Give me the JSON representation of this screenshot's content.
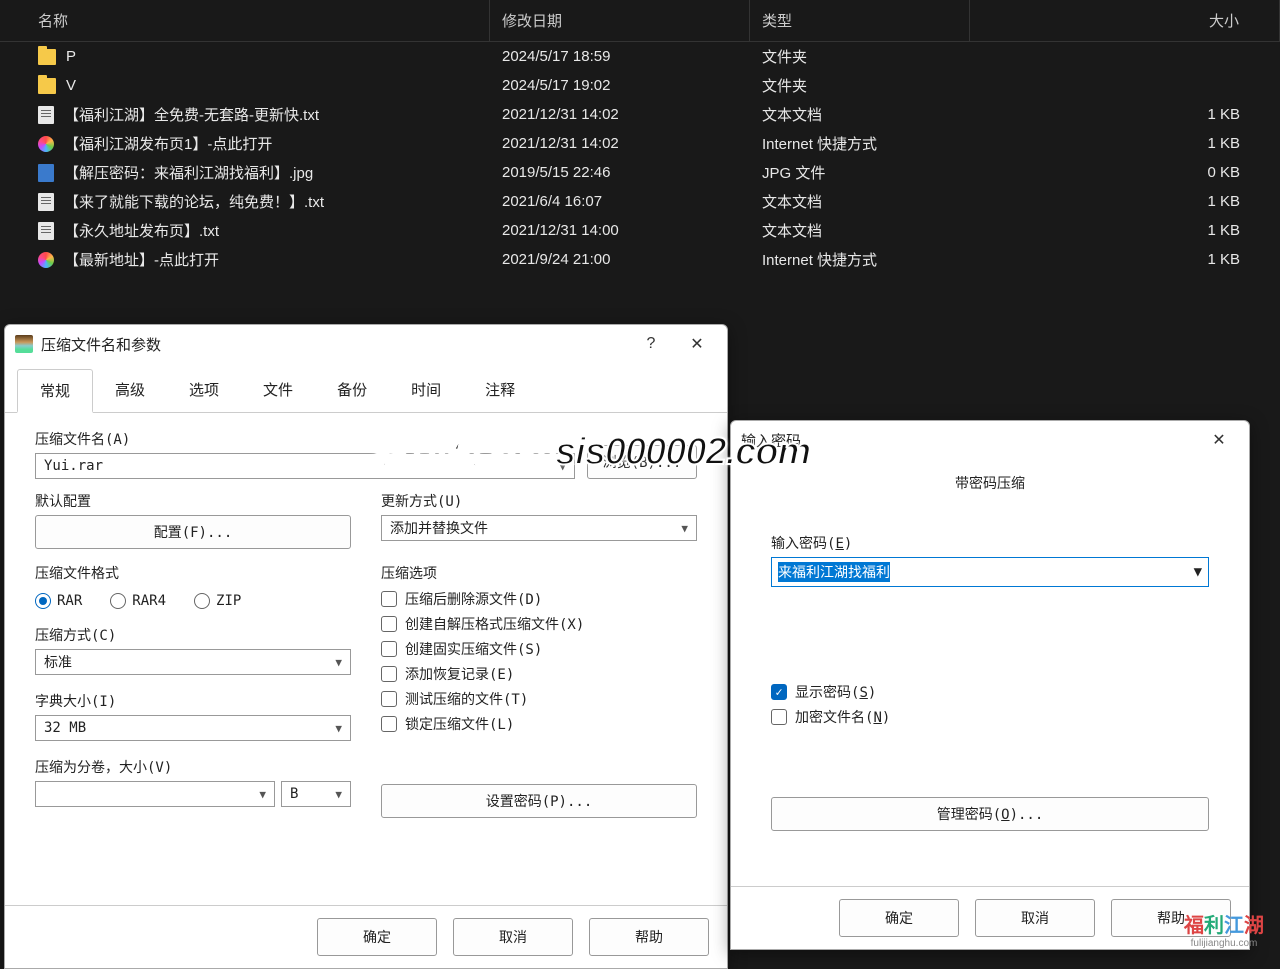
{
  "file_explorer": {
    "columns": {
      "name": "名称",
      "date": "修改日期",
      "type": "类型",
      "size": "大小"
    },
    "rows": [
      {
        "icon": "folder",
        "name": "P",
        "date": "2024/5/17 18:59",
        "type": "文件夹",
        "size": ""
      },
      {
        "icon": "folder",
        "name": "V",
        "date": "2024/5/17 19:02",
        "type": "文件夹",
        "size": ""
      },
      {
        "icon": "txt",
        "name": "【福利江湖】全免费-无套路-更新快.txt",
        "date": "2021/12/31 14:02",
        "type": "文本文档",
        "size": "1 KB"
      },
      {
        "icon": "link",
        "name": "【福利江湖发布页1】-点此打开",
        "date": "2021/12/31 14:02",
        "type": "Internet 快捷方式",
        "size": "1 KB"
      },
      {
        "icon": "jpg",
        "name": "【解压密码：来福利江湖找福利】.jpg",
        "date": "2019/5/15 22:46",
        "type": "JPG 文件",
        "size": "0 KB"
      },
      {
        "icon": "txt",
        "name": "【来了就能下载的论坛，纯免费！】.txt",
        "date": "2021/6/4 16:07",
        "type": "文本文档",
        "size": "1 KB"
      },
      {
        "icon": "txt",
        "name": "【永久地址发布页】.txt",
        "date": "2021/12/31 14:00",
        "type": "文本文档",
        "size": "1 KB"
      },
      {
        "icon": "link",
        "name": "【最新地址】-点此打开",
        "date": "2021/9/24 21:00",
        "type": "Internet 快捷方式",
        "size": "1 KB"
      }
    ]
  },
  "archive_dialog": {
    "title": "压缩文件名和参数",
    "help_symbol": "?",
    "close_symbol": "✕",
    "tabs": [
      "常规",
      "高级",
      "选项",
      "文件",
      "备份",
      "时间",
      "注释"
    ],
    "filename_label": "压缩文件名(A)",
    "filename_value": "Yui.rar",
    "browse_btn": "浏览(B)...",
    "default_profile_label": "默认配置",
    "profile_btn": "配置(F)...",
    "update_mode_label": "更新方式(U)",
    "update_mode_value": "添加并替换文件",
    "format_label": "压缩文件格式",
    "formats": [
      "RAR",
      "RAR4",
      "ZIP"
    ],
    "method_label": "压缩方式(C)",
    "method_value": "标准",
    "dict_label": "字典大小(I)",
    "dict_value": "32 MB",
    "split_label": "压缩为分卷，大小(V)",
    "split_value": "",
    "split_unit": "B",
    "options_label": "压缩选项",
    "options": [
      "压缩后删除源文件(D)",
      "创建自解压格式压缩文件(X)",
      "创建固实压缩文件(S)",
      "添加恢复记录(E)",
      "测试压缩的文件(T)",
      "锁定压缩文件(L)"
    ],
    "set_password_btn": "设置密码(P)...",
    "ok_btn": "确定",
    "cancel_btn": "取消",
    "help_btn": "帮助"
  },
  "password_dialog": {
    "title": "输入密码",
    "close_symbol": "✕",
    "subtitle": "带密码压缩",
    "password_label": "输入密码(E)",
    "password_value": "来福利江湖找福利",
    "show_password_label": "显示密码(S)",
    "encrypt_names_label": "加密文件名(N)",
    "organize_btn": "管理密码(O)...",
    "ok_btn": "确定",
    "cancel_btn": "取消",
    "help_btn": "帮助"
  },
  "watermark": "老司机发布sis000002.com",
  "brand": {
    "t1": "福",
    "t2": "利",
    "t3": "江",
    "t4": "湖",
    "sub": "fulijianghu.com"
  }
}
